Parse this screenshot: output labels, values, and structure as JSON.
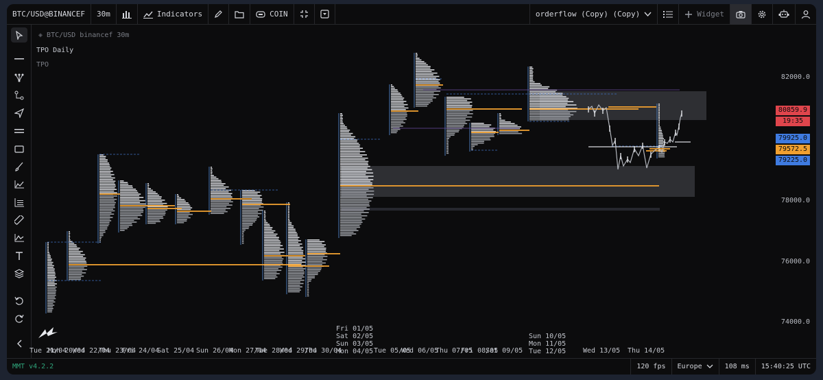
{
  "topbar": {
    "symbol": "BTC/USD@BINANCEF",
    "timeframe": "30m",
    "indicators_label": "Indicators",
    "coin_label": "COIN",
    "layout_name": "orderflow (Copy) (Copy)",
    "widget_label": "Widget"
  },
  "legend": {
    "symbol_line": "BTC/USD binancef 30m",
    "study_name": "TPO Daily",
    "study_short": "TPO"
  },
  "price_axis": {
    "labels": [
      "82000.0",
      "78000.0",
      "76000.0",
      "74000.0"
    ],
    "badges": {
      "last_price": "80859.9",
      "countdown": "19:35",
      "level_a": "79925.0",
      "level_b": "79572.5",
      "level_c": "79225.0"
    },
    "colors": {
      "last": "#e0454c",
      "blue": "#3f7be0",
      "orange": "#f0a030"
    }
  },
  "time_axis": {
    "labels": [
      "Tue 21/04",
      "Mon 20/04",
      "Wed 22/04",
      "Thu 23/04",
      "Fri 24/04",
      "Sat 25/04",
      "Sun 26/04",
      "Mon 27/04",
      "Tue 28/04",
      "Wed 29/04",
      "Thu 30/04",
      "Tue 05/05",
      "Wed 06/05",
      "Thu 07/05",
      "Fri 08/05",
      "Sat 09/05",
      "Wed 13/05",
      "Thu 14/05"
    ],
    "stack_a": [
      "Fri 01/05",
      "Sat 02/05",
      "Sun 03/05",
      "Mon 04/05"
    ],
    "stack_b": [
      "Sun 10/05",
      "Mon 11/05",
      "Tue 12/05"
    ]
  },
  "statusbar": {
    "version": "MMT v4.2.2",
    "fps": "120 fps",
    "region": "Europe",
    "latency": "108 ms",
    "time": "15:40:25 UTC"
  },
  "icons": [
    "cursor-icon",
    "horizontal-line-icon",
    "fork-icon",
    "path-icon",
    "arrow-icon",
    "parallel-icon",
    "rectangle-icon",
    "brush-icon",
    "chart-line-icon",
    "fib-icon",
    "ruler-icon",
    "measure-icon",
    "text-icon",
    "layers-icon",
    "undo-icon",
    "redo-icon",
    "collapse-icon"
  ]
}
